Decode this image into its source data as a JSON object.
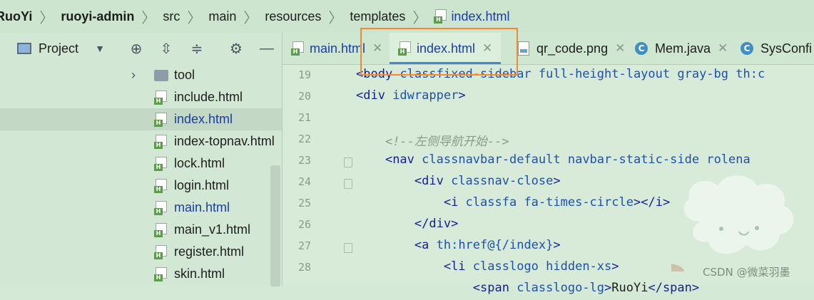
{
  "breadcrumb": [
    "RuoYi",
    "ruoyi-admin",
    "src",
    "main",
    "resources",
    "templates",
    "index.html"
  ],
  "project_panel": {
    "title": "Project",
    "tree": [
      {
        "label": "tool",
        "type": "folder",
        "selected": false,
        "link": false
      },
      {
        "label": "include.html",
        "type": "html",
        "selected": false,
        "link": false
      },
      {
        "label": "index.html",
        "type": "html",
        "selected": true,
        "link": true
      },
      {
        "label": "index-topnav.html",
        "type": "html",
        "selected": false,
        "link": false
      },
      {
        "label": "lock.html",
        "type": "html",
        "selected": false,
        "link": false
      },
      {
        "label": "login.html",
        "type": "html",
        "selected": false,
        "link": false
      },
      {
        "label": "main.html",
        "type": "html",
        "selected": false,
        "link": true
      },
      {
        "label": "main_v1.html",
        "type": "html",
        "selected": false,
        "link": false
      },
      {
        "label": "register.html",
        "type": "html",
        "selected": false,
        "link": false
      },
      {
        "label": "skin.html",
        "type": "html",
        "selected": false,
        "link": false
      }
    ]
  },
  "tabs": [
    {
      "label": "main.html",
      "icon": "html-file-icon",
      "active": false
    },
    {
      "label": "index.html",
      "icon": "html-file-icon",
      "active": true
    },
    {
      "label": "qr_code.png",
      "icon": "image-file-icon",
      "active": false
    },
    {
      "label": "Mem.java",
      "icon": "java-class-icon",
      "active": false
    },
    {
      "label": "SysConfi",
      "icon": "java-class-icon",
      "active": false
    }
  ],
  "code_lines": [
    {
      "n": "19",
      "text": "<body class=\"fixed-sidebar full-height-layout gray-bg\" th:c"
    },
    {
      "n": "20",
      "text": "<div id=\"wrapper\">"
    },
    {
      "n": "21",
      "text": ""
    },
    {
      "n": "22",
      "text": "    <!--左侧导航开始-->"
    },
    {
      "n": "23",
      "text": "    <nav class=\"navbar-default navbar-static-side\" role=\"na"
    },
    {
      "n": "24",
      "text": "        <div class=\"nav-close\">"
    },
    {
      "n": "25",
      "text": "            <i class=\"fa fa-times-circle\"></i>"
    },
    {
      "n": "26",
      "text": "        </div>"
    },
    {
      "n": "27",
      "text": "        <a th:href=\"@{/index}\">"
    },
    {
      "n": "28",
      "text": "            <li class=\"logo hidden-xs\">"
    },
    {
      "n": "",
      "text": "                <span class=\"logo-lg\">RuoYi</span>"
    }
  ],
  "watermark": "CSDN @微菜羽墨",
  "colors": {
    "highlight": "#f08a37",
    "active_tab_underline": "#4c88c8"
  }
}
